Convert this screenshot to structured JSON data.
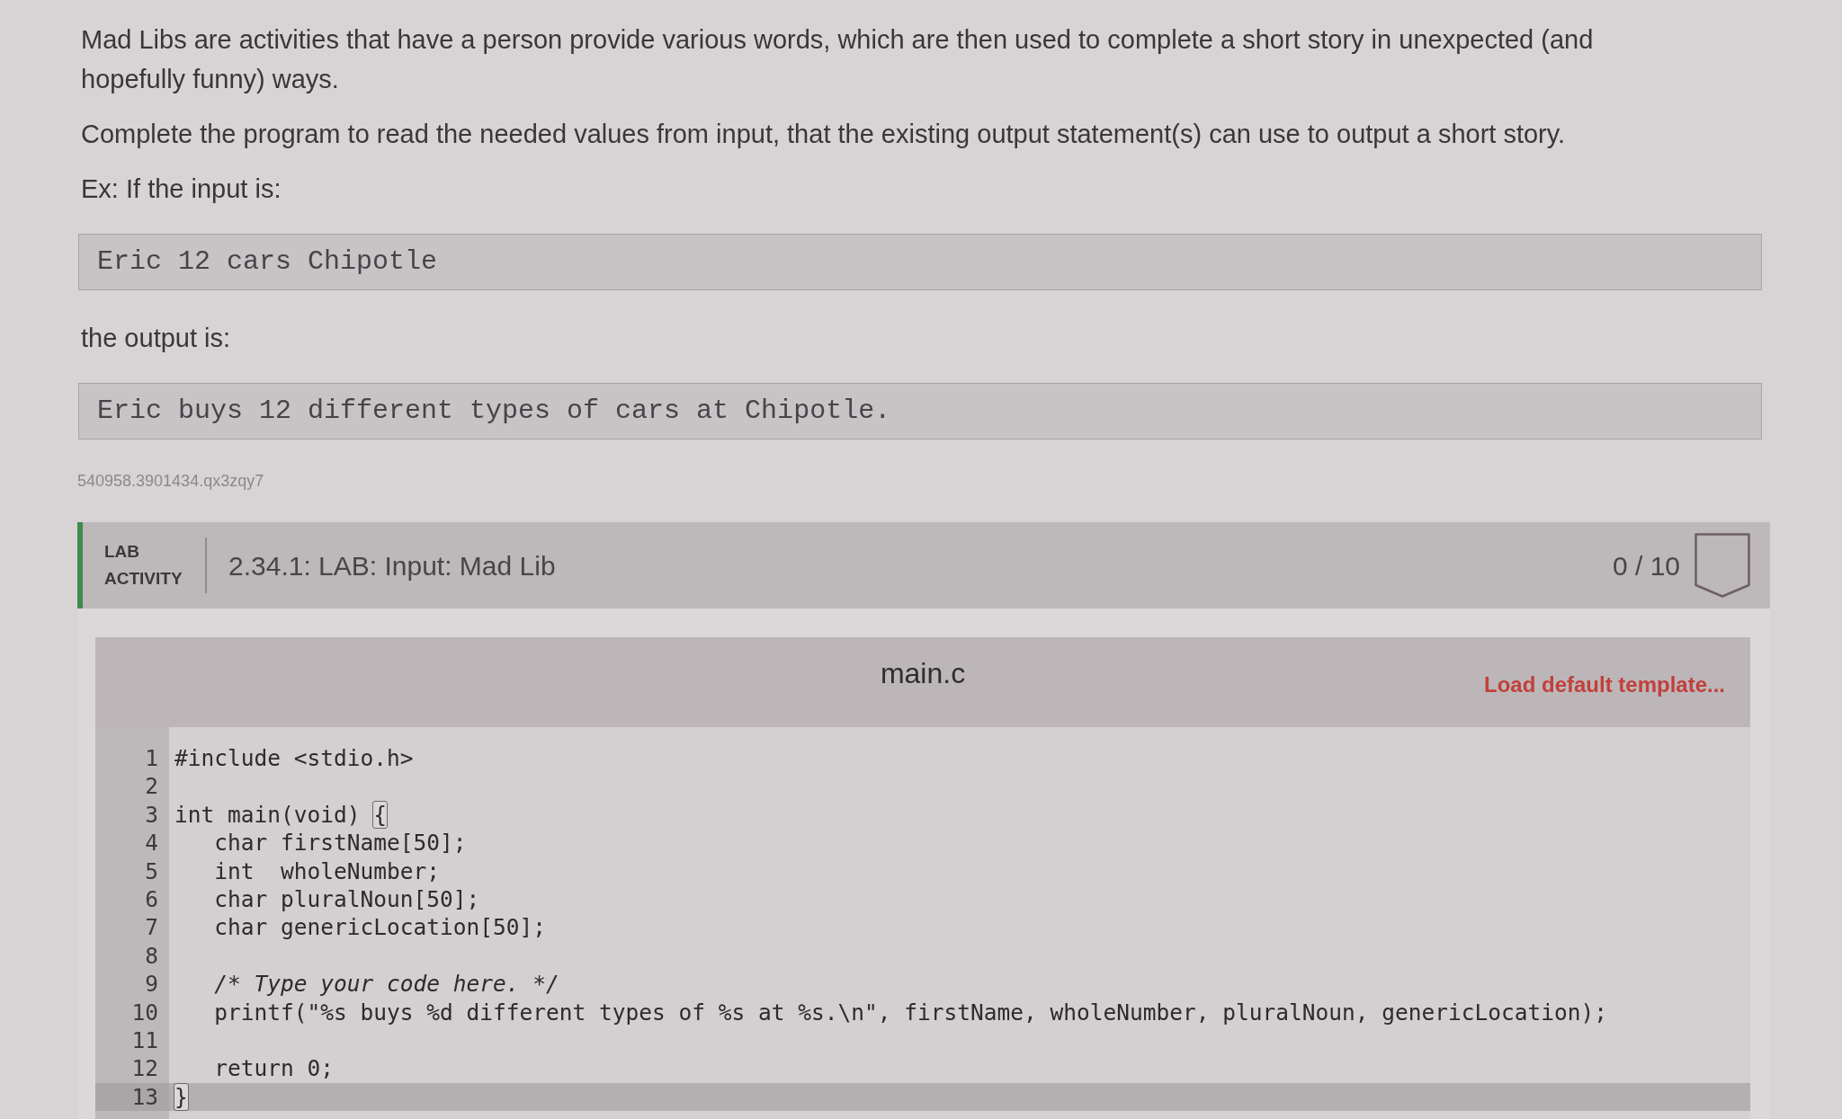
{
  "content": [
    {
      "kind": "text",
      "text": "Mad Libs are activities that have a person provide various words, which are then used to complete a short story in unexpected (and hopefully funny) ways."
    },
    {
      "kind": "text",
      "text": "Complete the program to read the needed values from input, that the existing output statement(s) can use to output a short story."
    },
    {
      "kind": "text",
      "text": "Ex: If the input is:"
    },
    {
      "kind": "sample",
      "text": "Eric 12 cars Chipotle"
    },
    {
      "kind": "text",
      "text": "the output is:"
    },
    {
      "kind": "sample",
      "text": "Eric buys 12 different types of cars at Chipotle."
    }
  ],
  "activity_id": "540958.3901434.qx3zqy7",
  "lab": {
    "label": "LAB ACTIVITY",
    "title": "2.34.1: LAB: Input: Mad Lib",
    "score": "0 / 10"
  },
  "editor": {
    "filename": "main.c",
    "load_template": "Load default template...",
    "lines": [
      {
        "number": "1",
        "active": false,
        "segments": [
          {
            "kind": "code",
            "text": "#include <stdio.h>"
          }
        ]
      },
      {
        "number": "2",
        "active": false
      },
      {
        "number": "3",
        "active": false,
        "segments": [
          {
            "kind": "code",
            "text": "int main(void) "
          },
          {
            "kind": "bracket",
            "text": "{"
          }
        ]
      },
      {
        "number": "4",
        "active": false,
        "segments": [
          {
            "kind": "code",
            "text": "   char firstName[50];"
          }
        ]
      },
      {
        "number": "5",
        "active": false,
        "segments": [
          {
            "kind": "code",
            "text": "   int  wholeNumber;"
          }
        ]
      },
      {
        "number": "6",
        "active": false,
        "segments": [
          {
            "kind": "code",
            "text": "   char pluralNoun[50];"
          }
        ]
      },
      {
        "number": "7",
        "active": false,
        "segments": [
          {
            "kind": "code",
            "text": "   char genericLocation[50];"
          }
        ]
      },
      {
        "number": "8",
        "active": false
      },
      {
        "number": "9",
        "active": false,
        "segments": [
          {
            "kind": "comment",
            "text": "   /* Type your code here. */"
          }
        ]
      },
      {
        "number": "10",
        "active": false,
        "segments": [
          {
            "kind": "code",
            "text": "   printf(\"%s buys %d different types of %s at %s.\\n\", firstName, wholeNumber, pluralNoun, genericLocation);"
          }
        ]
      },
      {
        "number": "11",
        "active": false
      },
      {
        "number": "12",
        "active": false,
        "segments": [
          {
            "kind": "code",
            "text": "   return 0;"
          }
        ]
      },
      {
        "number": "13",
        "active": true,
        "segments": [
          {
            "kind": "bracket",
            "text": "}"
          }
        ]
      }
    ]
  }
}
